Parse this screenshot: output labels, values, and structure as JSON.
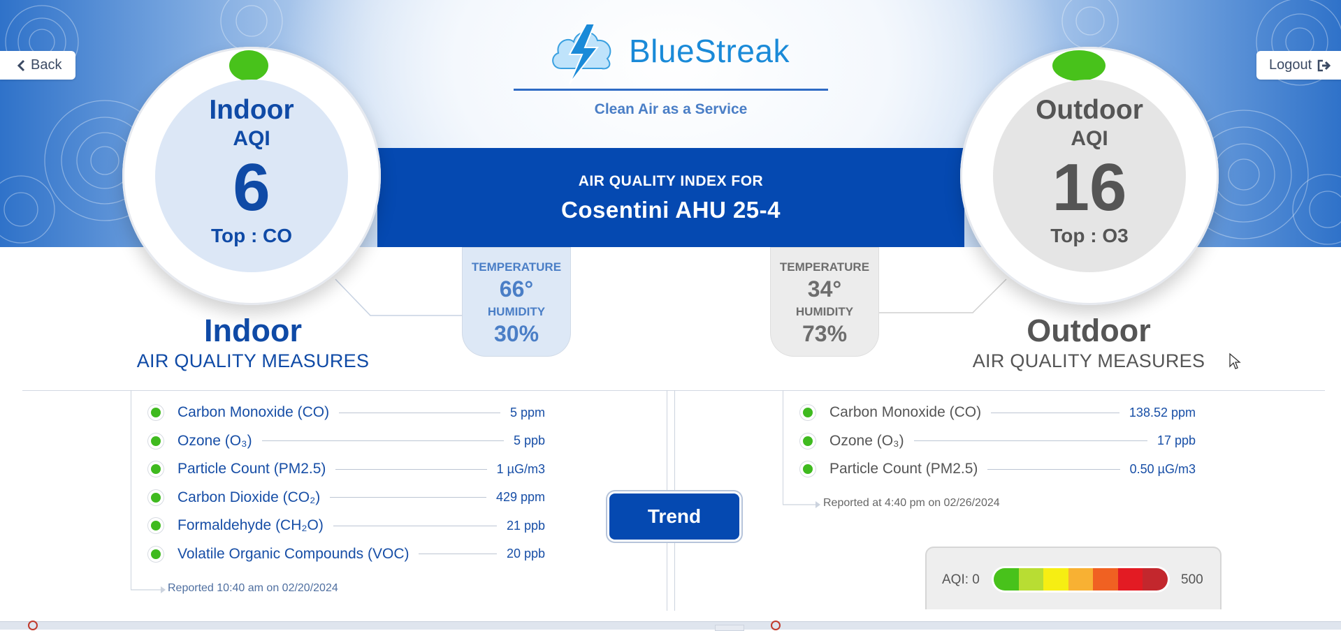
{
  "brand": {
    "name": "BlueStreak",
    "tagline": "Clean Air as a Service"
  },
  "nav": {
    "back_label": "Back",
    "logout_label": "Logout"
  },
  "header": {
    "index_label": "AIR QUALITY INDEX FOR",
    "site_name": "Cosentini AHU 25-4"
  },
  "indoor": {
    "aqi_title": "Indoor",
    "aqi_sub": "AQI",
    "aqi_value": "6",
    "top_pollutant": "Top : CO",
    "status_color": "#48c21b",
    "temperature_label": "TEMPERATURE",
    "temperature": "66°",
    "humidity_label": "HUMIDITY",
    "humidity": "30%",
    "section_title": "Indoor",
    "section_subtitle": "AIR QUALITY MEASURES",
    "measures": [
      {
        "name": "Carbon Monoxide (CO)",
        "value": "5 ppm"
      },
      {
        "name": "Ozone (O₃)",
        "value": "5 ppb"
      },
      {
        "name": "Particle Count (PM2.5)",
        "value": "1 µG/m3"
      },
      {
        "name": "Carbon Dioxide (CO₂)",
        "value": "429 ppm"
      },
      {
        "name": "Formaldehyde (CH₂O)",
        "value": "21 ppb"
      },
      {
        "name": "Volatile Organic Compounds (VOC)",
        "value": "20 ppb"
      }
    ],
    "reported": "Reported 10:40 am on 02/20/2024"
  },
  "outdoor": {
    "aqi_title": "Outdoor",
    "aqi_sub": "AQI",
    "aqi_value": "16",
    "top_pollutant": "Top : O3",
    "status_color": "#48c21b",
    "temperature_label": "TEMPERATURE",
    "temperature": "34°",
    "humidity_label": "HUMIDITY",
    "humidity": "73%",
    "section_title": "Outdoor",
    "section_subtitle": "AIR QUALITY MEASURES",
    "measures": [
      {
        "name": "Carbon Monoxide (CO)",
        "value": "138.52 ppm"
      },
      {
        "name": "Ozone (O₃)",
        "value": "17 ppb"
      },
      {
        "name": "Particle Count (PM2.5)",
        "value": "0.50 µG/m3"
      }
    ],
    "reported": "Reported at 4:40 pm on 02/26/2024"
  },
  "trend_button_label": "Trend",
  "aqi_scale": {
    "low_label": "AQI: 0",
    "high_label": "500",
    "colors": [
      "#48c21b",
      "#b8dd33",
      "#f6ee13",
      "#f8b133",
      "#f06122",
      "#e31b23",
      "#c3272d"
    ]
  },
  "colors": {
    "brand_blue": "#0549b1",
    "indoor_text": "#0f4aa6",
    "outdoor_text": "#555555",
    "good_status": "#48c21b"
  },
  "icons": {
    "logo": "cloud-lightning-icon",
    "back": "chevron-left-icon",
    "logout": "sign-out-icon",
    "status": "status-dot-icon"
  }
}
